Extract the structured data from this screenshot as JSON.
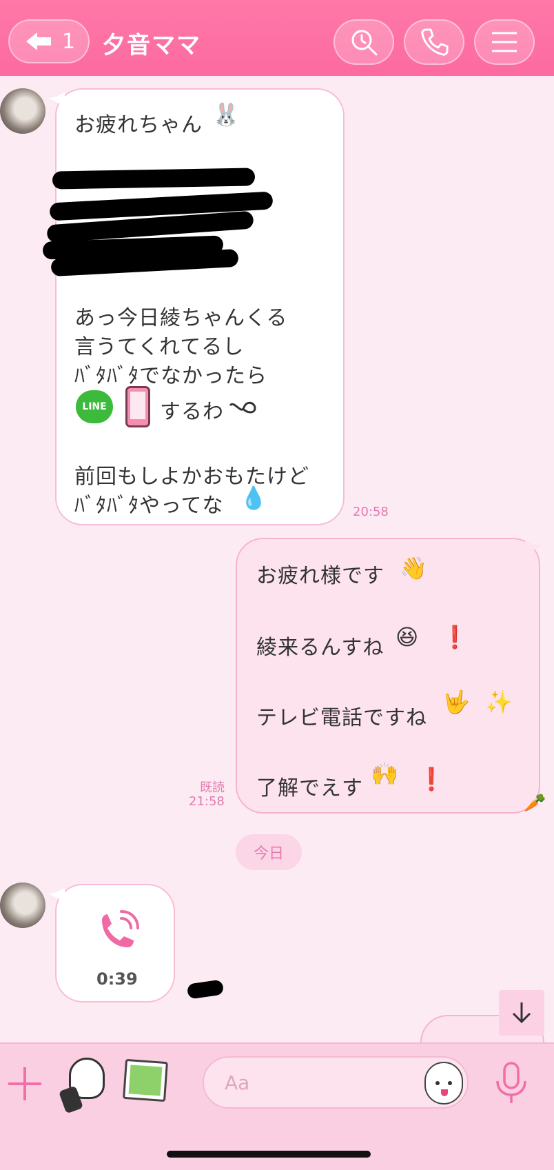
{
  "header": {
    "back_count": "1",
    "title": "夕音ママ",
    "icons": [
      "back-arrow-icon",
      "search-icon",
      "phone-icon",
      "menu-icon"
    ]
  },
  "messages": [
    {
      "direction": "in",
      "lines_top": [
        "お疲れちゃん"
      ],
      "lines_mid": [
        "あっ今日綾ちゃんくる",
        "言うてくれてるし",
        "ﾊﾞﾀﾊﾞﾀでなかったら"
      ],
      "line_line": "するわ",
      "lines_bottom": [
        "前回もしよかおもたけど",
        "ﾊﾞﾀﾊﾞﾀやってな"
      ],
      "time": "20:58"
    },
    {
      "direction": "out",
      "lines": [
        "お疲れ様です",
        "綾来るんすね",
        "テレビ電話ですね",
        "了解でえす"
      ],
      "read": "既読",
      "time": "21:58"
    }
  ],
  "date_label": "今日",
  "call": {
    "duration": "0:39"
  },
  "input": {
    "placeholder": "Aa"
  },
  "colors": {
    "header": "#fc6aa0",
    "background": "#fdebf3",
    "accent": "#e47ab0"
  }
}
